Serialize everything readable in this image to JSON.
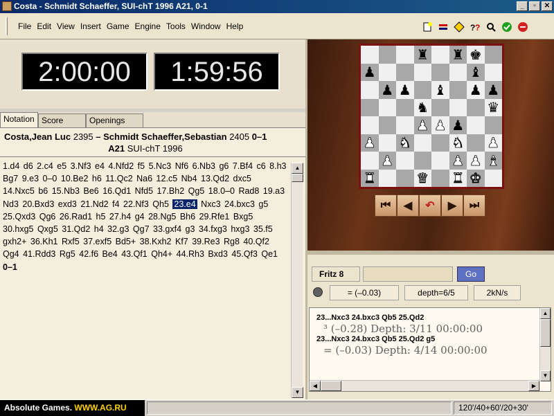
{
  "window": {
    "title": "Costa - Schmidt Schaeffer, SUI-chT 1996  A21, 0-1",
    "btn_min": "_",
    "btn_max": "▫",
    "btn_close": "✕"
  },
  "menu": [
    "File",
    "Edit",
    "View",
    "Insert",
    "Game",
    "Engine",
    "Tools",
    "Window",
    "Help"
  ],
  "toolbar_icons": [
    "new-game-icon",
    "flip-board-icon",
    "analysis-icon",
    "hint-icon",
    "search-icon",
    "accept-icon",
    "stop-icon"
  ],
  "clocks": {
    "white": "2:00:00",
    "black": "1:59:56"
  },
  "tabs": [
    "Notation",
    "Score sheet",
    "Openings Book"
  ],
  "game": {
    "white": "Costa,Jean Luc",
    "white_elo": "2395",
    "sep": "–",
    "black": "Schmidt Schaeffer,Sebastian",
    "black_elo": "2405",
    "result": "0–1",
    "eco": "A21",
    "event": "SUI-chT 1996",
    "moves_before": "1.d4  d6  2.c4  e5  3.Nf3  e4  4.Nfd2  f5  5.Nc3  Nf6  6.Nb3  g6  7.Bf4  c6  8.h3  Bg7  9.e3  0–0  10.Be2  h6  11.Qc2  Na6  12.c5  Nb4  13.Qd2  dxc5  14.Nxc5  b6  15.Nb3  Be6  16.Qd1  Nfd5  17.Bh2  Qg5  18.0–0  Rad8  19.a3  Nd3  20.Bxd3  exd3  21.Nd2  f4  22.Nf3  Qh5 ",
    "current_move": "23.e4",
    "moves_after": " Nxc3  24.bxc3  g5  25.Qxd3  Qg6  26.Rad1  h5  27.h4  g4  28.Ng5  Bh6  29.Rfe1  Bxg5  30.hxg5  Qxg5  31.Qd2  h4  32.g3  Qg7  33.gxf4  g3  34.fxg3  hxg3  35.f5  gxh2+  36.Kh1  Rxf5  37.exf5  Bd5+  38.Kxh2  Kf7  39.Re3  Rg8  40.Qf2  Qg4  41.Rdd3  Rg5  42.f6  Be4  43.Qf1  Qh4+  44.Rh3  Bxd3  45.Qf3  Qe1",
    "final": "0–1"
  },
  "board": [
    [
      "",
      "",
      "",
      "r",
      "",
      "r",
      "k",
      ""
    ],
    [
      "p",
      "",
      "",
      "",
      "",
      "",
      "b",
      ""
    ],
    [
      "",
      "p",
      "p",
      "",
      "b",
      "",
      "p",
      "p"
    ],
    [
      "",
      "",
      "",
      "n",
      "",
      "",
      "",
      "q"
    ],
    [
      "",
      "",
      "",
      "P",
      "P",
      "p",
      "",
      ""
    ],
    [
      "P",
      "",
      "N",
      "",
      "",
      "N",
      "",
      "P"
    ],
    [
      "",
      "P",
      "",
      "",
      "",
      "P",
      "P",
      "B"
    ],
    [
      "R",
      "",
      "",
      "Q",
      "",
      "R",
      "K",
      ""
    ]
  ],
  "nav_buttons": [
    "⏮",
    "◀",
    "↶",
    "▶",
    "⏭"
  ],
  "engine": {
    "name": "Fritz 8",
    "go": "Go",
    "eval": "= (–0.03)",
    "depth": "depth=6/5",
    "speed": "2kN/s",
    "lines": [
      {
        "pv": "23...Nxc3 24.bxc3 Qb5 25.Qd2",
        "info": "³  (–0.28)   Depth: 3/11   00:00:00"
      },
      {
        "pv": "23...Nxc3 24.bxc3 Qb5 25.Qd2 g5",
        "info": "=  (–0.03)   Depth: 4/14   00:00:00"
      }
    ]
  },
  "status": {
    "banner_prefix": "Absolute Games. ",
    "banner_site": "WWW.AG.RU",
    "time_control": "120'/40+60'/20+30'"
  }
}
